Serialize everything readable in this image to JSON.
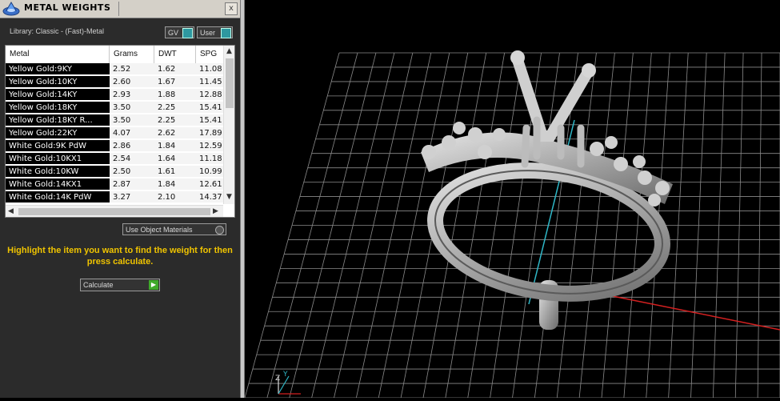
{
  "window": {
    "title": "METAL WEIGHTS",
    "close_label": "x"
  },
  "library": {
    "label": "Library: Classic - (Fast)-Metal"
  },
  "toggles": {
    "gv": "GV",
    "user": "User"
  },
  "table": {
    "columns": [
      "Metal",
      "Grams",
      "DWT",
      "SPG"
    ],
    "rows": [
      [
        "Yellow Gold:9KY",
        "2.52",
        "1.62",
        "11.08"
      ],
      [
        "Yellow Gold:10KY",
        "2.60",
        "1.67",
        "11.45"
      ],
      [
        "Yellow Gold:14KY",
        "2.93",
        "1.88",
        "12.88"
      ],
      [
        "Yellow Gold:18KY",
        "3.50",
        "2.25",
        "15.41"
      ],
      [
        "Yellow Gold:18KY R...",
        "3.50",
        "2.25",
        "15.41"
      ],
      [
        "Yellow Gold:22KY",
        "4.07",
        "2.62",
        "17.89"
      ],
      [
        "White Gold:9K PdW",
        "2.86",
        "1.84",
        "12.59"
      ],
      [
        "White Gold:10KX1",
        "2.54",
        "1.64",
        "11.18"
      ],
      [
        "White Gold:10KW",
        "2.50",
        "1.61",
        "10.99"
      ],
      [
        "White Gold:14KX1",
        "2.87",
        "1.84",
        "12.61"
      ],
      [
        "White Gold:14K PdW",
        "3.27",
        "2.10",
        "14.37"
      ]
    ]
  },
  "use_object_materials": {
    "label": "Use Object Materials"
  },
  "instruction": {
    "text": "Highlight the item you want to find the weight for then press calculate."
  },
  "calculate": {
    "label": "Calculate"
  },
  "viewport": {
    "axis_labels": {
      "z": "Z",
      "y": "Y"
    },
    "colors": {
      "background": "#000000",
      "grid": "#8a8a8a",
      "y_axis": "#2fb8c8",
      "x_axis": "#d42020",
      "metal": "#b4b4b4"
    }
  },
  "icons": [
    "app-logo-icon",
    "close-icon",
    "toggle-switch-icon",
    "scroll-up-icon",
    "scroll-down-icon",
    "scroll-left-icon",
    "scroll-right-icon",
    "radio-icon",
    "play-arrow-icon",
    "axis-gizmo-icon"
  ]
}
